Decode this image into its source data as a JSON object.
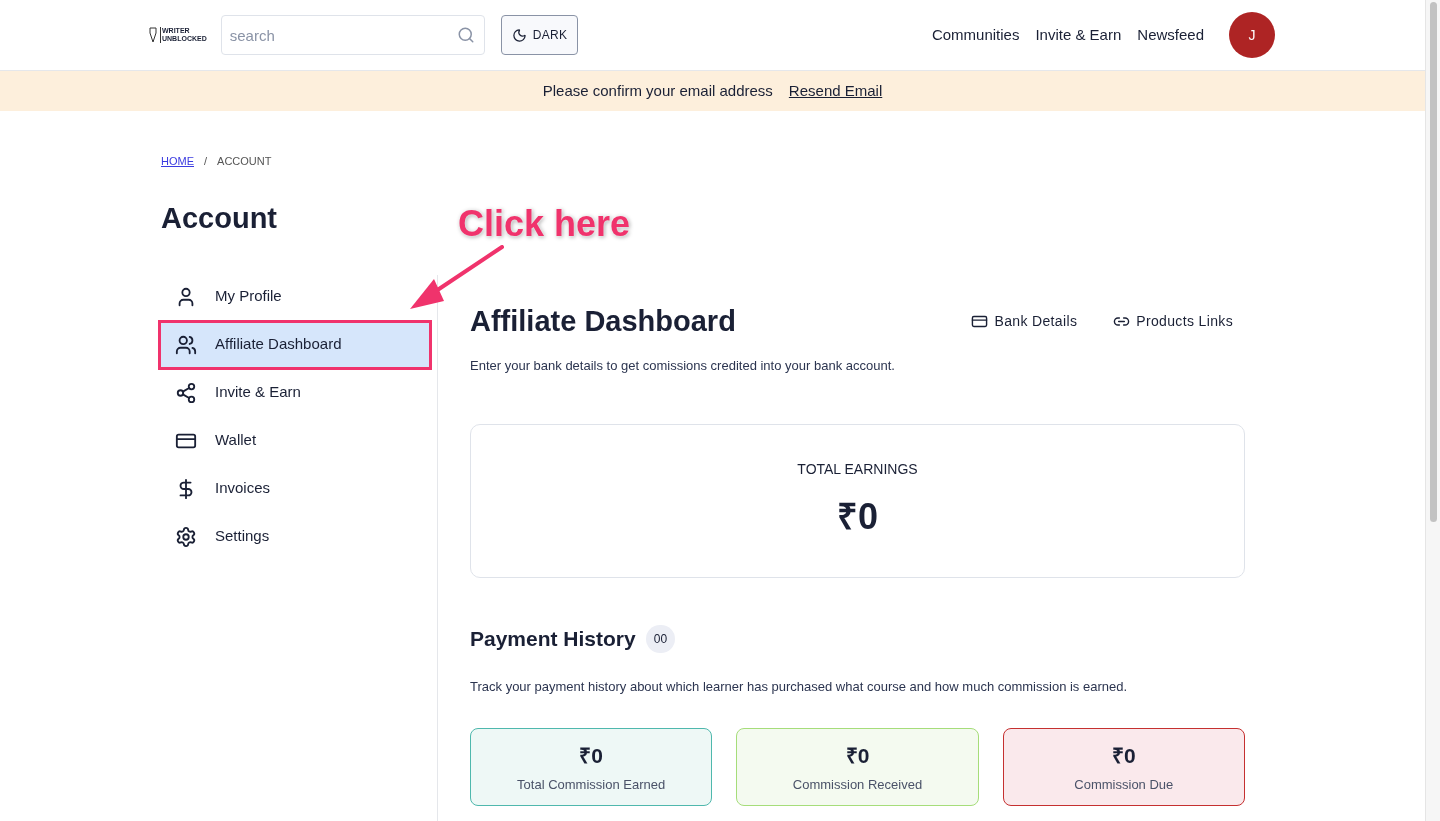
{
  "header": {
    "logo": [
      "WRITER",
      "UNBLOCKED"
    ],
    "search": {
      "placeholder": "search"
    },
    "theme_button": "DARK",
    "nav": [
      "Communities",
      "Invite & Earn",
      "Newsfeed"
    ],
    "avatar": "J"
  },
  "banner": {
    "text": "Please confirm your email address",
    "link": "Resend Email"
  },
  "breadcrumb": {
    "items": [
      "HOME",
      "ACCOUNT"
    ],
    "separator": "/"
  },
  "sidebar": {
    "title": "Account",
    "items": [
      {
        "label": "My Profile",
        "selected": false
      },
      {
        "label": "Affiliate Dashboard",
        "selected": true
      },
      {
        "label": "Invite & Earn",
        "selected": false
      },
      {
        "label": "Wallet",
        "selected": false
      },
      {
        "label": "Invoices",
        "selected": false
      },
      {
        "label": "Settings",
        "selected": false
      }
    ]
  },
  "annotation": {
    "text": "Click here"
  },
  "main": {
    "title": "Affiliate Dashboard",
    "actions": [
      "Bank Details",
      "Products Links"
    ],
    "subtitle": "Enter your bank details to get comissions credited into your bank account.",
    "total": {
      "label": "TOTAL EARNINGS",
      "value": "₹0"
    },
    "history": {
      "title": "Payment History",
      "count": "00",
      "description": "Track your payment history about which learner has purchased what course and how much commission is earned.",
      "stats": [
        {
          "value": "₹0",
          "label": "Total Commission Earned",
          "kind": "earned"
        },
        {
          "value": "₹0",
          "label": "Commission Received",
          "kind": "received"
        },
        {
          "value": "₹0",
          "label": "Commission Due",
          "kind": "due"
        }
      ]
    }
  }
}
